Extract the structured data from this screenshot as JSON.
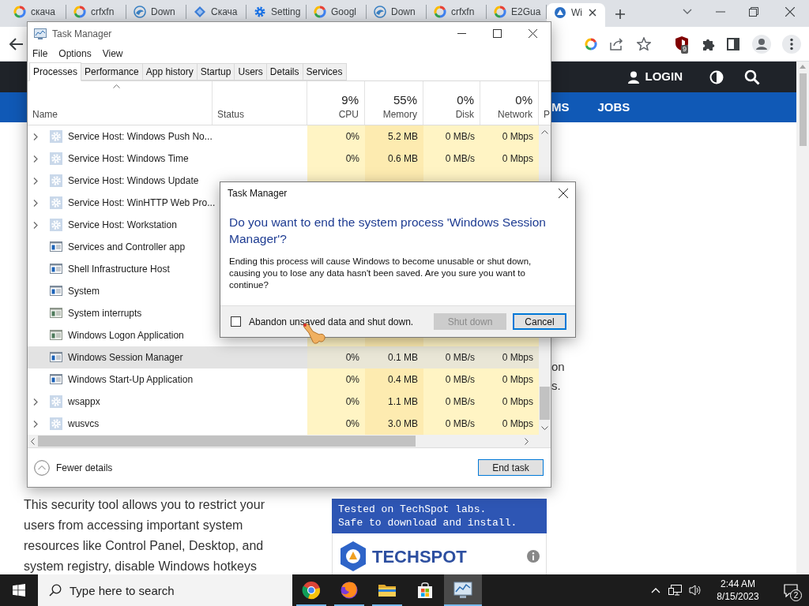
{
  "browser": {
    "tabs": [
      {
        "title": "скача",
        "kind": "ring",
        "selected": false
      },
      {
        "title": "crfxfn",
        "kind": "ring",
        "selected": false
      },
      {
        "title": "Down",
        "kind": "swirl",
        "selected": false
      },
      {
        "title": "Скача",
        "kind": "diamond",
        "selected": false
      },
      {
        "title": "Setting",
        "kind": "gear",
        "selected": false
      },
      {
        "title": "Googl",
        "kind": "ring",
        "selected": false
      },
      {
        "title": "Down",
        "kind": "swirl",
        "selected": false
      },
      {
        "title": "crfxfn",
        "kind": "ring",
        "selected": false
      },
      {
        "title": "E2Gua",
        "kind": "ring",
        "selected": false
      },
      {
        "title": "Wi",
        "kind": "triangle",
        "selected": true
      }
    ],
    "extension_badge": "9"
  },
  "site": {
    "login": "LOGIN",
    "nav_items": [
      "MS",
      "JOBS"
    ],
    "right_fragments": [
      "on",
      "s."
    ],
    "paragraph": "This security tool allows you to restrict your users from accessing important system resources like Control Panel, Desktop, and system registry, disable Windows hotkeys",
    "card": {
      "tested_lines": [
        "Tested on TechSpot labs.",
        "Safe to download and install."
      ],
      "logo": "TECHSPOT"
    }
  },
  "task_manager": {
    "title": "Task Manager",
    "menu": [
      "File",
      "Options",
      "View"
    ],
    "tabs": [
      {
        "label": "Processes",
        "selected": true
      },
      {
        "label": "Performance",
        "selected": false
      },
      {
        "label": "App history",
        "selected": false
      },
      {
        "label": "Startup",
        "selected": false
      },
      {
        "label": "Users",
        "selected": false
      },
      {
        "label": "Details",
        "selected": false
      },
      {
        "label": "Services",
        "selected": false
      }
    ],
    "columns": [
      {
        "label": "Name"
      },
      {
        "label": "Status"
      },
      {
        "percent": "9%",
        "label": "CPU"
      },
      {
        "percent": "55%",
        "label": "Memory"
      },
      {
        "percent": "0%",
        "label": "Disk"
      },
      {
        "percent": "0%",
        "label": "Network"
      },
      {
        "label": "P"
      }
    ],
    "rows": [
      {
        "name": "Service Host: Windows Push No...",
        "kind": "service",
        "expandable": true,
        "selected": false,
        "cpu": "0%",
        "memory": "5.2 MB",
        "disk": "0 MB/s",
        "network": "0 Mbps"
      },
      {
        "name": "Service Host: Windows Time",
        "kind": "service",
        "expandable": true,
        "selected": false,
        "cpu": "0%",
        "memory": "0.6 MB",
        "disk": "0 MB/s",
        "network": "0 Mbps"
      },
      {
        "name": "Service Host: Windows Update",
        "kind": "service",
        "expandable": true,
        "selected": false
      },
      {
        "name": "Service Host: WinHTTP Web Pro...",
        "kind": "service",
        "expandable": true,
        "selected": false
      },
      {
        "name": "Service Host: Workstation",
        "kind": "service",
        "expandable": true,
        "selected": false
      },
      {
        "name": "Services and Controller app",
        "kind": "app",
        "expandable": false,
        "selected": false
      },
      {
        "name": "Shell Infrastructure Host",
        "kind": "app",
        "expandable": false,
        "selected": false
      },
      {
        "name": "System",
        "kind": "app",
        "expandable": false,
        "selected": false
      },
      {
        "name": "System interrupts",
        "kind": "system",
        "expandable": false,
        "selected": false
      },
      {
        "name": "Windows Logon Application",
        "kind": "system",
        "expandable": false,
        "selected": false
      },
      {
        "name": "Windows Session Manager",
        "kind": "app",
        "expandable": false,
        "selected": true,
        "cpu": "0%",
        "memory": "0.1 MB",
        "disk": "0 MB/s",
        "network": "0 Mbps"
      },
      {
        "name": "Windows Start-Up Application",
        "kind": "app",
        "expandable": false,
        "selected": false,
        "cpu": "0%",
        "memory": "0.4 MB",
        "disk": "0 MB/s",
        "network": "0 Mbps"
      },
      {
        "name": "wsappx",
        "kind": "service",
        "expandable": true,
        "selected": false,
        "cpu": "0%",
        "memory": "1.1 MB",
        "disk": "0 MB/s",
        "network": "0 Mbps"
      },
      {
        "name": "wusvcs",
        "kind": "service",
        "expandable": true,
        "selected": false,
        "cpu": "0%",
        "memory": "3.0 MB",
        "disk": "0 MB/s",
        "network": "0 Mbps"
      }
    ],
    "fewer_details": "Fewer details",
    "end_task": "End task"
  },
  "dialog": {
    "title": "Task Manager",
    "heading": "Do you want to end the system process 'Windows Session Manager'?",
    "body": "Ending this process will cause Windows to become unusable or shut down, causing you to lose any data hasn't been saved. Are you sure you want to continue?",
    "checkbox": {
      "label": "Abandon unsaved data and shut down.",
      "checked": false
    },
    "buttons": [
      {
        "label": "Shut down",
        "disabled": true,
        "focused": false
      },
      {
        "label": "Cancel",
        "disabled": false,
        "focused": true
      }
    ]
  },
  "taskbar": {
    "search_placeholder": "Type here to search",
    "apps": [
      {
        "kind": "browser",
        "running": true,
        "selected": false
      },
      {
        "kind": "globe",
        "running": true,
        "selected": false
      },
      {
        "kind": "folder",
        "running": true,
        "selected": false
      },
      {
        "kind": "bag",
        "running": false,
        "selected": false
      },
      {
        "kind": "monitor",
        "running": true,
        "selected": true
      }
    ],
    "time": "2:44 AM",
    "date": "8/15/2023",
    "notifications": "2"
  }
}
